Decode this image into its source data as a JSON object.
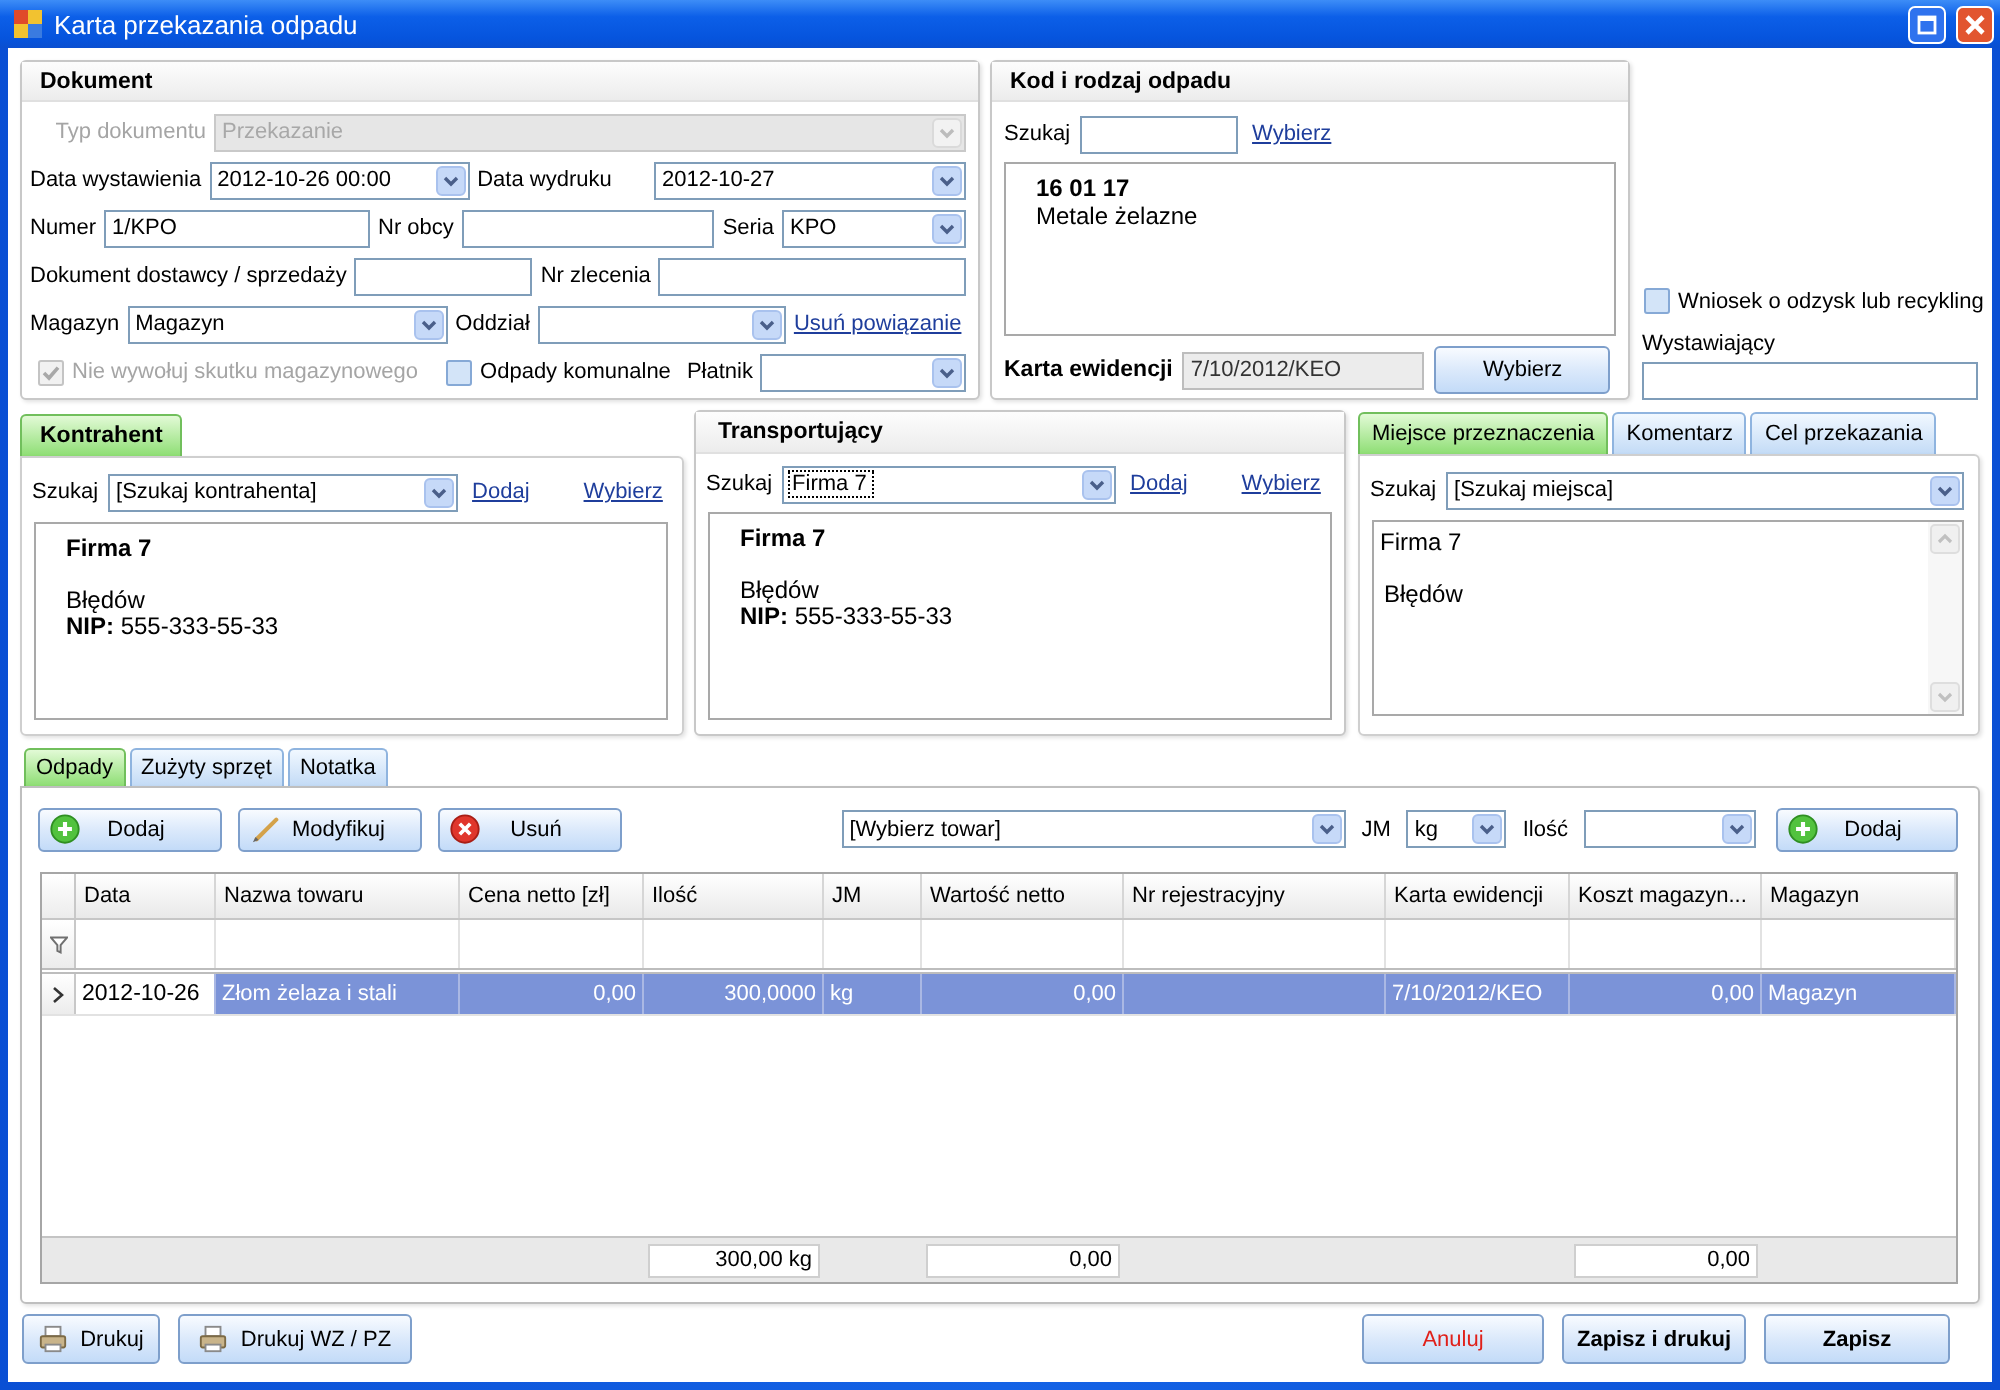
{
  "window": {
    "title": "Karta przekazania odpadu"
  },
  "document": {
    "title": "Dokument",
    "doc_type": {
      "label": "Typ dokumentu",
      "value": "Przekazanie",
      "disabled": true
    },
    "issue_date": {
      "label": "Data wystawienia",
      "value": "2012-10-26 00:00"
    },
    "print_date": {
      "label": "Data wydruku",
      "value": "2012-10-27"
    },
    "number": {
      "label": "Numer",
      "value": "1/KPO"
    },
    "external_no": {
      "label": "Nr obcy"
    },
    "series": {
      "label": "Seria",
      "value": "KPO"
    },
    "supplier_doc": {
      "label": "Dokument dostawcy / sprzedaży"
    },
    "order_no": {
      "label": "Nr zlecenia"
    },
    "warehouse": {
      "label": "Magazyn",
      "value": "Magazyn"
    },
    "branch": {
      "label": "Oddział"
    },
    "unlink_link": "Usuń powiązanie",
    "no_stock_effect": {
      "label": "Nie wywołuj skutku magazynowego",
      "checked": true,
      "disabled": true
    },
    "municipal_waste": {
      "label": "Odpady komunalne",
      "checked": false,
      "disabled": false
    },
    "payer": {
      "label": "Płatnik"
    }
  },
  "waste_code": {
    "title": "Kod i rodzaj odpadu",
    "search_label": "Szukaj",
    "choose_link": "Wybierz",
    "code": "16 01 17",
    "name": "Metale żelazne",
    "record_card": {
      "label": "Karta ewidencji",
      "value": "7/10/2012/KEO"
    },
    "choose_button": "Wybierz"
  },
  "recovery_request": {
    "label": "Wniosek o odzysk lub recykling",
    "checked": false,
    "disabled": false
  },
  "issuer": {
    "label": "Wystawiający"
  },
  "contractor": {
    "tabs": [
      {
        "label": "Kontrahent",
        "selected": true
      }
    ],
    "search_label": "Szukaj",
    "search_value": "[Szukaj kontrahenta]",
    "add_link": "Dodaj",
    "choose_link": "Wybierz",
    "name": "Firma 7",
    "city": "Błędów",
    "tax_id": "**NIP:** 555-333-55-33"
  },
  "carrier": {
    "title": "Transportujący",
    "search_label": "Szukaj",
    "search_value": "Firma 7",
    "focused": true,
    "add_link": "Dodaj",
    "choose_link": "Wybierz",
    "name": "Firma 7",
    "city": "Błędów",
    "tax_id": "**NIP:** 555-333-55-33"
  },
  "destination": {
    "tabs": [
      {
        "label": "Miejsce przeznaczenia",
        "selected": true
      },
      {
        "label": "Komentarz",
        "selected": false
      },
      {
        "label": "Cel przekazania",
        "selected": false
      }
    ],
    "search_label": "Szukaj",
    "search_value": "[Szukaj miejsca]",
    "lines": [
      "Firma 7",
      "Błędów"
    ]
  },
  "items": {
    "tabs": [
      {
        "label": "Odpady",
        "selected": true
      },
      {
        "label": "Zużyty sprzęt",
        "selected": false
      },
      {
        "label": "Notatka",
        "selected": false
      }
    ],
    "toolbar": [
      {
        "kind": "add",
        "label": "Dodaj"
      },
      {
        "kind": "edit",
        "label": "Modyfikuj"
      },
      {
        "kind": "delete",
        "label": "Usuń"
      }
    ],
    "product": {
      "value": "[Wybierz towar]"
    },
    "unit": {
      "label": "JM",
      "value": "kg"
    },
    "quantity": {
      "label": "Ilość"
    },
    "add_button": {
      "kind": "add",
      "label": "Dodaj"
    },
    "table": {
      "columns": [
        "Data",
        "Nazwa towaru",
        "Cena netto [zł]",
        "Ilość",
        "JM",
        "Wartość netto",
        "Nr rejestracyjny",
        "Karta ewidencji",
        "Koszt magazyn...",
        "Magazyn"
      ],
      "rows": [
        {
          "selected": true,
          "current": true,
          "cells": [
            "2012-10-26",
            "Złom żelaza i stali",
            "0,00",
            "300,0000",
            "kg",
            "0,00",
            null,
            "7/10/2012/KEO",
            "0,00",
            "Magazyn"
          ]
        }
      ],
      "totals": {
        "quantity": "300,00 kg",
        "net_value": "0,00",
        "storage_cost": "0,00"
      }
    }
  },
  "footer": {
    "left": [
      {
        "kind": "print",
        "label": "Drukuj"
      },
      {
        "kind": "print",
        "label": "Drukuj WZ / PZ"
      }
    ],
    "right": [
      {
        "kind": "cancel",
        "label": "Anuluj"
      },
      {
        "kind": "save",
        "label": "Zapisz i drukuj"
      },
      {
        "kind": "save",
        "label": "Zapisz"
      }
    ]
  }
}
